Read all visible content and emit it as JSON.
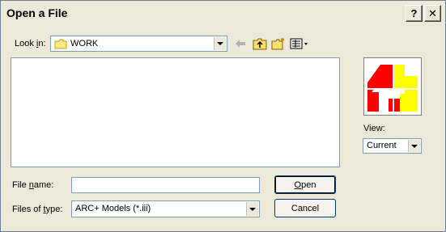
{
  "window": {
    "title": "Open a File"
  },
  "titlebar_buttons": {
    "help": "?",
    "close": "✕"
  },
  "look_in": {
    "label_pre": "Look ",
    "label_u": "i",
    "label_post": "n:",
    "value": "WORK"
  },
  "toolbar": {
    "back_icon": "back-arrow-icon",
    "up_icon": "up-folder-icon",
    "new_icon": "new-folder-icon",
    "view_icon": "view-menu-icon"
  },
  "file_name": {
    "label_pre": "File ",
    "label_u": "n",
    "label_post": "ame:",
    "value": ""
  },
  "files_of_type": {
    "label_pre": "Files of ",
    "label_u": "t",
    "label_post": "ype:",
    "value": "ARC+ Models (*.iii)"
  },
  "buttons": {
    "open_u": "O",
    "open_rest": "pen",
    "cancel": "Cancel"
  },
  "view": {
    "label": "View:",
    "value": "Current"
  },
  "colors": {
    "accent_red": "#ff0000",
    "accent_yellow": "#ffff00",
    "dialog_bg": "#ece9d8",
    "field_border": "#7f9db9"
  }
}
